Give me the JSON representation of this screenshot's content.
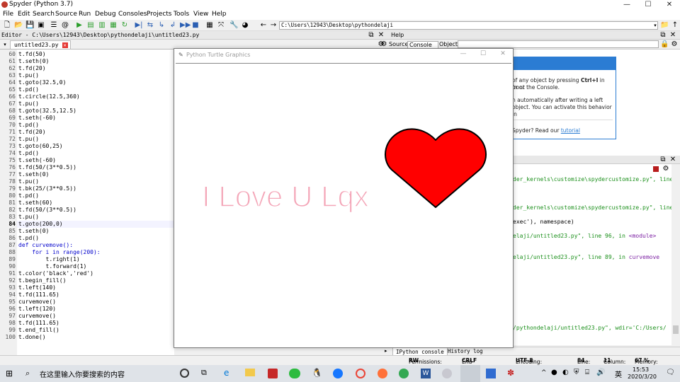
{
  "window": {
    "title": "Spyder (Python 3.7)",
    "min": "—",
    "max": "☐",
    "close": "✕"
  },
  "menu": [
    "File",
    "Edit",
    "Search",
    "Source",
    "Run",
    "Debug",
    "Consoles",
    "Projects",
    "Tools",
    "View",
    "Help"
  ],
  "toolbar": {
    "path": "C:\\Users\\12943\\Desktop\\pythondelaji"
  },
  "editor": {
    "header": "Editor - C:\\Users\\12943\\Desktop\\pythondelaji\\untitled23.py",
    "tab": "untitled23.py",
    "current_line": "84",
    "lines": [
      {
        "n": "60",
        "code": "t.fd(50)"
      },
      {
        "n": "61",
        "code": "t.seth(0)"
      },
      {
        "n": "62",
        "code": "t.fd(20)"
      },
      {
        "n": "63",
        "code": "t.pu()"
      },
      {
        "n": "64",
        "code": "t.goto(32.5,0)"
      },
      {
        "n": "65",
        "code": "t.pd()"
      },
      {
        "n": "66",
        "code": "t.circle(12.5,360)"
      },
      {
        "n": "67",
        "code": "t.pu()"
      },
      {
        "n": "68",
        "code": "t.goto(32.5,12.5)"
      },
      {
        "n": "69",
        "code": "t.seth(-60)"
      },
      {
        "n": "70",
        "code": "t.pd()"
      },
      {
        "n": "71",
        "code": "t.fd(20)"
      },
      {
        "n": "72",
        "code": "t.pu()"
      },
      {
        "n": "73",
        "code": "t.goto(60,25)"
      },
      {
        "n": "74",
        "code": "t.pd()"
      },
      {
        "n": "75",
        "code": "t.seth(-60)"
      },
      {
        "n": "76",
        "code": "t.fd(50/(3**0.5))"
      },
      {
        "n": "77",
        "code": "t.seth(0)"
      },
      {
        "n": "78",
        "code": "t.pu()"
      },
      {
        "n": "79",
        "code": "t.bk(25/(3**0.5))"
      },
      {
        "n": "80",
        "code": "t.pd()"
      },
      {
        "n": "81",
        "code": "t.seth(60)"
      },
      {
        "n": "82",
        "code": "t.fd(50/(3**0.5))"
      },
      {
        "n": "83",
        "code": "t.pu()"
      },
      {
        "n": "84",
        "code": "t.goto(200,0)"
      },
      {
        "n": "85",
        "code": "t.seth(0)"
      },
      {
        "n": "86",
        "code": "t.pd()"
      },
      {
        "n": "87",
        "code": "def curvemove():"
      },
      {
        "n": "88",
        "code": "    for i in range(200):"
      },
      {
        "n": "89",
        "code": "        t.right(1)"
      },
      {
        "n": "90",
        "code": "        t.forward(1)"
      },
      {
        "n": "91",
        "code": "t.color('black','red')"
      },
      {
        "n": "92",
        "code": "t.begin_fill()"
      },
      {
        "n": "93",
        "code": "t.left(140)"
      },
      {
        "n": "94",
        "code": "t.fd(111.65)"
      },
      {
        "n": "95",
        "code": "curvemove()"
      },
      {
        "n": "96",
        "code": "t.left(120)"
      },
      {
        "n": "97",
        "code": "curvemove()"
      },
      {
        "n": "98",
        "code": "t.fd(111.65)"
      },
      {
        "n": "99",
        "code": "t.end_fill()"
      },
      {
        "n": "100",
        "code": "t.done()"
      }
    ]
  },
  "help": {
    "header": "Help",
    "source_label": "Source",
    "source_value": "Console",
    "object_label": "Object",
    "line1_pre": "of any object by pressing ",
    "line1_key": "Ctrl+I",
    "line1_post": " in front",
    "line2": "or or the Console.",
    "line3": "n automatically after writing a left",
    "line4": "object. You can activate this behavior in",
    "line5_pre": "Spyder? Read our ",
    "line5_link": "tutorial"
  },
  "console": {
    "lines": [
      {
        "a": "der_kernels\\customize\\spydercustomize.py\", line",
        "b": ""
      },
      {
        "a": "der_kernels\\customize\\spydercustomize.py\", line",
        "b": ""
      },
      {
        "a": "exec'), namespace)",
        "b": ""
      },
      {
        "a": "elaji/untitled23.py\", line 96, in ",
        "b": "<module>"
      },
      {
        "a": "elaji/untitled23.py\", line 89, in ",
        "b": "curvemove"
      },
      {
        "a": "/pythondelaji/untitled23.py\", wdir=",
        "b": "'C:/Users/"
      }
    ],
    "tab1": "IPython console",
    "tab2": "History log"
  },
  "status": {
    "permissions_label": "Permissions:",
    "permissions": "RW",
    "eol_label": "End-of-lines:",
    "eol": "CRLF",
    "encoding_label": "Encoding:",
    "encoding": "UTF-8",
    "line_label": "Line:",
    "line": "84",
    "col_label": "Column:",
    "col": "11",
    "mem_label": "Memory:",
    "mem": "67 %"
  },
  "turtle": {
    "title": "Python Turtle Graphics",
    "text": "I Love U Lqx",
    "text_color": "#f4a6b8",
    "heart_fill": "#ff0000",
    "heart_stroke": "#000000"
  },
  "taskbar": {
    "search_placeholder": "在这里输入你要搜索的内容",
    "time": "15:53",
    "date": "2020/3/20",
    "ime": "英"
  }
}
